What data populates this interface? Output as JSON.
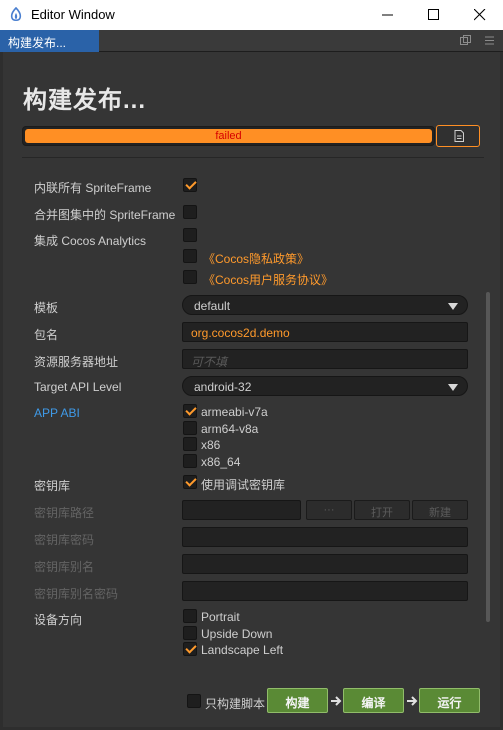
{
  "window": {
    "title": "Editor Window"
  },
  "tab": {
    "label": "构建发布..."
  },
  "panel": {
    "heading": "构建发布...",
    "progress": {
      "text": "failed",
      "value": 1.0
    }
  },
  "form": {
    "inline_spriteframe": {
      "label": "内联所有 SpriteFrame",
      "checked": true
    },
    "merge_spriteframe": {
      "label": "合并图集中的 SpriteFrame",
      "checked": false
    },
    "analytics": {
      "label": "集成 Cocos Analytics",
      "checked": false
    },
    "privacy_link": "《Cocos隐私政策》",
    "service_link": "《Cocos用户服务协议》",
    "template": {
      "label": "模板",
      "value": "default"
    },
    "package": {
      "label": "包名",
      "value": "org.cocos2d.demo"
    },
    "asset_server": {
      "label": "资源服务器地址",
      "placeholder": "可不填"
    },
    "target_api": {
      "label": "Target API Level",
      "value": "android-32"
    },
    "app_abi": {
      "label": "APP ABI",
      "options": [
        {
          "label": "armeabi-v7a",
          "checked": true
        },
        {
          "label": "arm64-v8a",
          "checked": false
        },
        {
          "label": "x86",
          "checked": false
        },
        {
          "label": "x86_64",
          "checked": false
        }
      ]
    },
    "keystore": {
      "label": "密钥库",
      "checkbox_label": "使用调试密钥库",
      "checked": true
    },
    "keystore_path": {
      "label": "密钥库路径",
      "browse": "···",
      "open": "打开",
      "new": "新建"
    },
    "keystore_password": {
      "label": "密钥库密码"
    },
    "keystore_alias": {
      "label": "密钥库别名"
    },
    "alias_password": {
      "label": "密钥库别名密码"
    },
    "orientation": {
      "label": "设备方向",
      "options": [
        {
          "label": "Portrait",
          "checked": false
        },
        {
          "label": "Upside Down",
          "checked": false
        },
        {
          "label": "Landscape Left",
          "checked": true
        }
      ]
    }
  },
  "footer": {
    "script_only": {
      "label": "只构建脚本",
      "checked": false
    },
    "build": "构建",
    "compile": "编译",
    "run": "运行"
  },
  "colors": {
    "accent": "#ff9a2c",
    "tab": "#2a62a8",
    "action_green": "#5a8a35",
    "error_text": "#d60000",
    "link_blue": "#3f9ae8"
  }
}
